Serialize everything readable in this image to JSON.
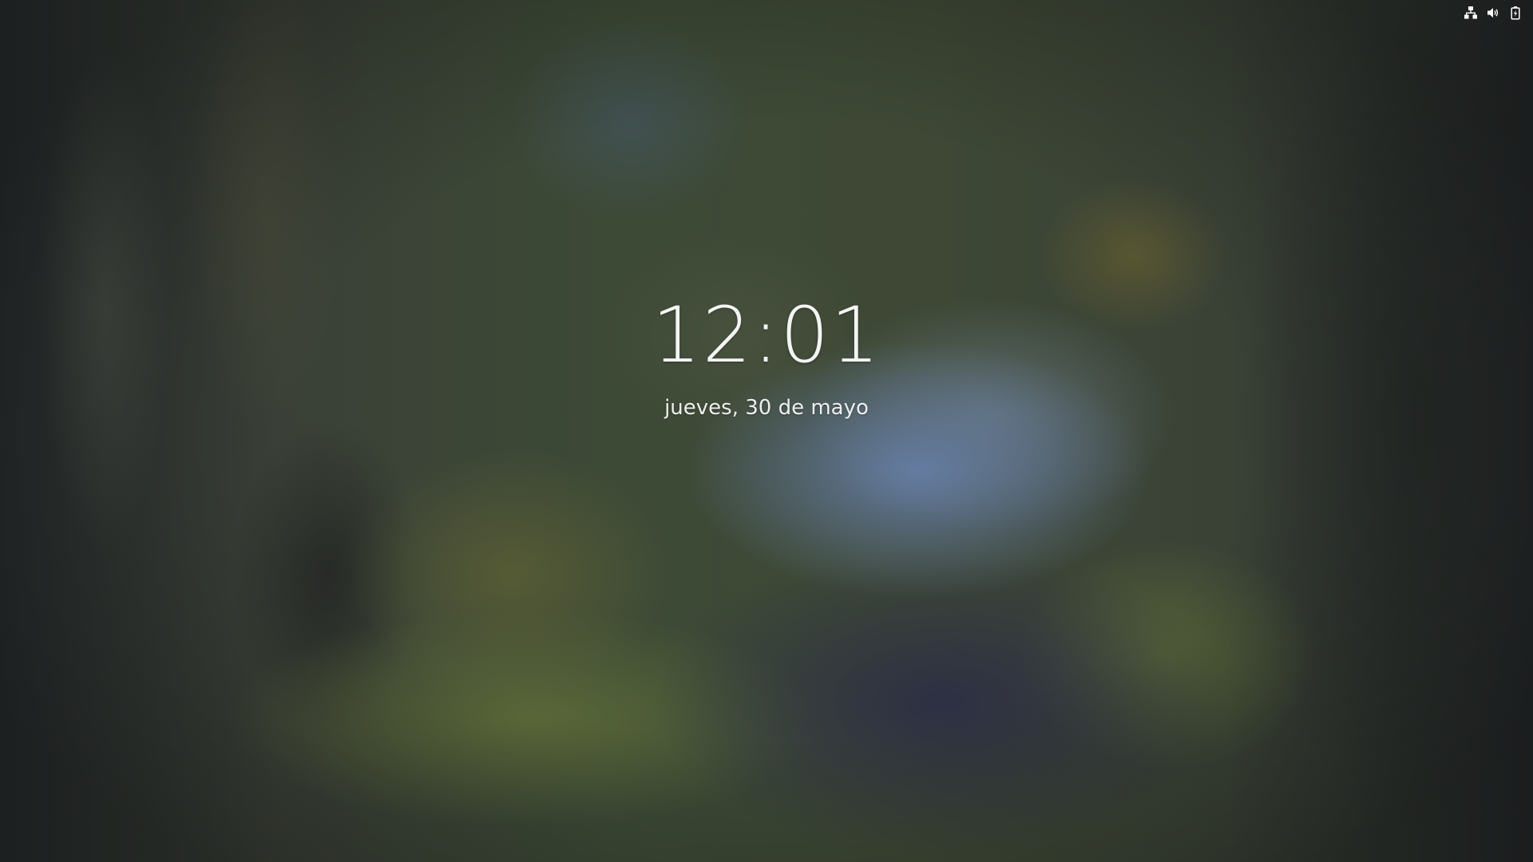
{
  "lock_screen": {
    "time": "12:01",
    "date": "jueves, 30 de mayo"
  },
  "system_tray": {
    "icons": [
      "network-wired-icon",
      "volume-icon",
      "battery-icon"
    ]
  },
  "colors": {
    "text": "#f2f2f2",
    "icon": "#ffffff"
  }
}
